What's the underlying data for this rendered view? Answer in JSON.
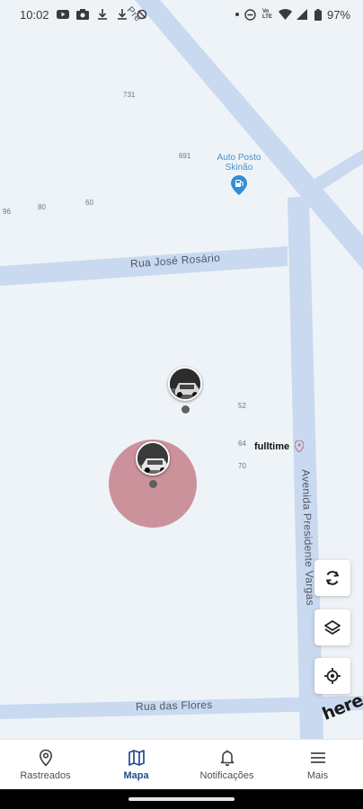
{
  "status_bar": {
    "time": "10:02",
    "left_icons": [
      "youtube-icon",
      "camera-icon",
      "download-icon",
      "download-icon",
      "sync-icon"
    ],
    "right_icons": [
      "dot-icon",
      "do-not-disturb-icon",
      "volte-icon",
      "wifi-icon",
      "signal-icon",
      "battery-icon"
    ],
    "volte_text": "Vo\nLTE",
    "battery": "97%"
  },
  "map": {
    "poi": {
      "name_line1": "Auto Posto",
      "name_line2": "Skinão",
      "icon": "fuel-station-icon",
      "color": "#2f8fd8"
    },
    "streets": {
      "rua_jose_rosario": "Rua José Rosário",
      "avenida_presidente_vargas": "Avenida Presidente Vargas",
      "rua_das_flores": "Rua das Flores"
    },
    "house_numbers": {
      "n731": "731",
      "n691": "691",
      "n96": "96",
      "n80": "80",
      "n60": "60",
      "n52": "52",
      "n64": "64",
      "n70": "70"
    },
    "place_label": {
      "text": "fulltime",
      "icon": "location-pin-icon"
    },
    "markers": [
      {
        "name": "vehicle-1",
        "icon": "car-photo-icon"
      },
      {
        "name": "vehicle-2",
        "icon": "car-photo-icon",
        "accuracy_circle_color": "#c98a94"
      }
    ],
    "controls": [
      "refresh-icon",
      "layers-icon",
      "my-location-icon"
    ],
    "brand": "here"
  },
  "bottom_nav": {
    "items": [
      {
        "label": "Rastreados",
        "icon": "location-pin-icon",
        "active": false
      },
      {
        "label": "Mapa",
        "icon": "map-icon",
        "active": true
      },
      {
        "label": "Notificações",
        "icon": "bell-icon",
        "active": false
      },
      {
        "label": "Mais",
        "icon": "menu-icon",
        "active": false
      }
    ],
    "active_color": "#1f4b8f"
  }
}
